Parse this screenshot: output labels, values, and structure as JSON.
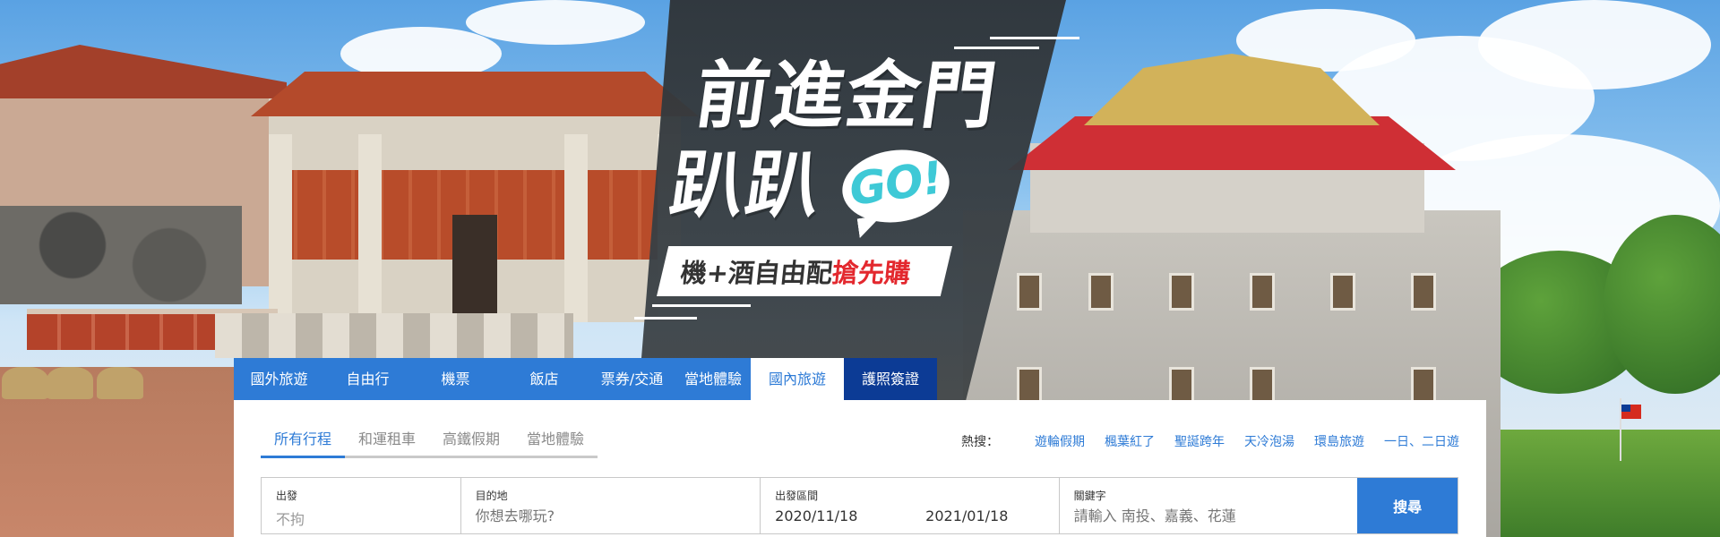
{
  "banner": {
    "headline_line1": "前進金門",
    "headline_line2": "趴趴",
    "go_badge": "GO!",
    "tagline_part1": "機+酒自由配",
    "tagline_highlight": "搶先購"
  },
  "main_tabs": [
    {
      "label": "國外旅遊"
    },
    {
      "label": "自由行"
    },
    {
      "label": "機票"
    },
    {
      "label": "飯店"
    },
    {
      "label": "票券/交通"
    },
    {
      "label": "當地體驗"
    },
    {
      "label": "國內旅遊",
      "active": true
    },
    {
      "label": "護照簽證"
    }
  ],
  "sub_tabs": [
    {
      "label": "所有行程",
      "active": true
    },
    {
      "label": "和運租車"
    },
    {
      "label": "高鐵假期"
    },
    {
      "label": "當地體驗"
    }
  ],
  "hot_search": {
    "label": "熱搜：",
    "links": [
      "遊輪假期",
      "楓葉紅了",
      "聖誕跨年",
      "天冷泡湯",
      "環島旅遊",
      "一日、二日遊"
    ]
  },
  "search_form": {
    "departure_label": "出發",
    "departure_value": "不拘",
    "destination_label": "目的地",
    "destination_placeholder": "你想去哪玩?",
    "date_label": "出發區間",
    "date_start": "2020/11/18",
    "date_end": "2021/01/18",
    "keyword_label": "關鍵字",
    "keyword_placeholder": "請輸入 南投、嘉義、花蓮",
    "search_button": "搜尋"
  },
  "colors": {
    "primary_blue": "#2e7bd6",
    "dark_blue": "#0c3b95",
    "highlight_red": "#e3282e",
    "go_cyan": "#3ec9d6"
  }
}
